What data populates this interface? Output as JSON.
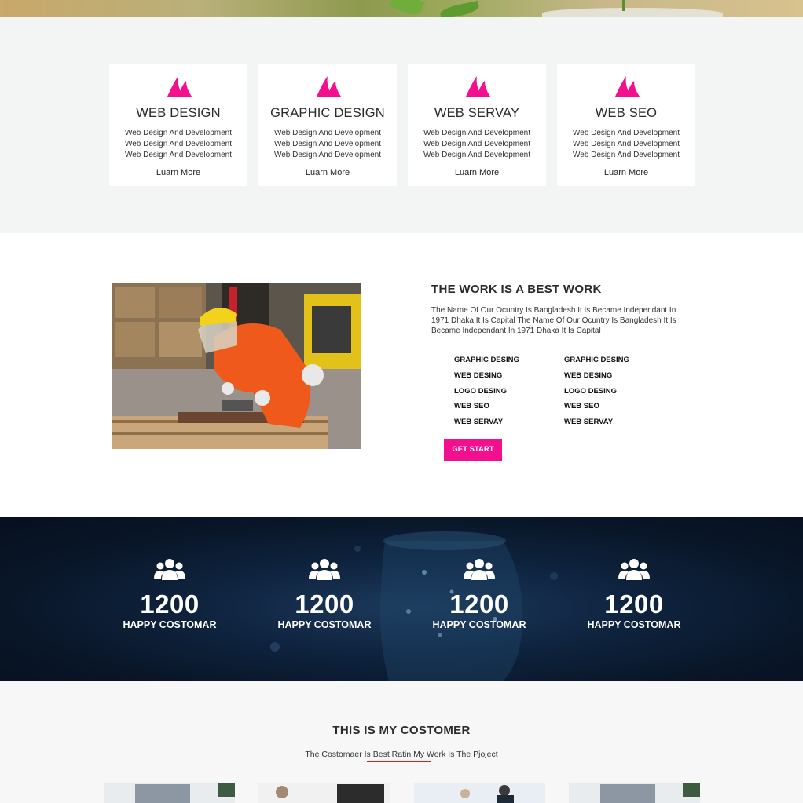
{
  "colors": {
    "accent": "#f30f8e",
    "services_bg": "#f3f5f5",
    "counter_bg": "#0f2440",
    "underline": "#e01b1b"
  },
  "services": {
    "cards": [
      {
        "icon": "fin-logo-icon",
        "title": "WEB DESIGN",
        "desc": [
          "Web Design And Development",
          "Web Design And Development",
          "Web Design And Development"
        ],
        "link": "Luarn More"
      },
      {
        "icon": "fin-logo-icon",
        "title": "GRAPHIC DESIGN",
        "desc": [
          "Web Design And Development",
          "Web Design And Development",
          "Web Design And Development"
        ],
        "link": "Luarn More"
      },
      {
        "icon": "fin-logo-icon",
        "title": "WEB SERVAY",
        "desc": [
          "Web Design And Development",
          "Web Design And Development",
          "Web Design And Development"
        ],
        "link": "Luarn More"
      },
      {
        "icon": "fin-logo-icon",
        "title": "WEB SEO",
        "desc": [
          "Web Design And Development",
          "Web Design And Development",
          "Web Design And Development"
        ],
        "link": "Luarn More"
      }
    ]
  },
  "about": {
    "heading": "THE WORK IS A BEST WORK",
    "text": "The Name Of Our Ocuntry Is Bangladesh It Is Became Independant In 1971 Dhaka It Is Capital The Name Of Our Ocuntry Is Bangladesh It Is Became Independant In 1971 Dhaka It Is Capital",
    "skills_left": [
      "GRAPHIC DESING",
      "WEB DESING",
      "LOGO DESING",
      "WEB SEO",
      "WEB SERVAY"
    ],
    "skills_right": [
      "GRAPHIC DESING",
      "WEB DESING",
      "LOGO DESING",
      "WEB SEO",
      "WEB SERVAY"
    ],
    "button": "GET START"
  },
  "counters": [
    {
      "icon": "people-group-icon",
      "number": "1200",
      "label": "HAPPY COSTOMAR"
    },
    {
      "icon": "people-group-icon",
      "number": "1200",
      "label": "HAPPY COSTOMAR"
    },
    {
      "icon": "people-group-icon",
      "number": "1200",
      "label": "HAPPY COSTOMAR"
    },
    {
      "icon": "people-group-icon",
      "number": "1200",
      "label": "HAPPY COSTOMAR"
    }
  ],
  "customers": {
    "heading": "THIS IS MY COSTOMER",
    "subtitle": "The Costomaer Is Best Ratin My Work Is The Pjoject"
  }
}
